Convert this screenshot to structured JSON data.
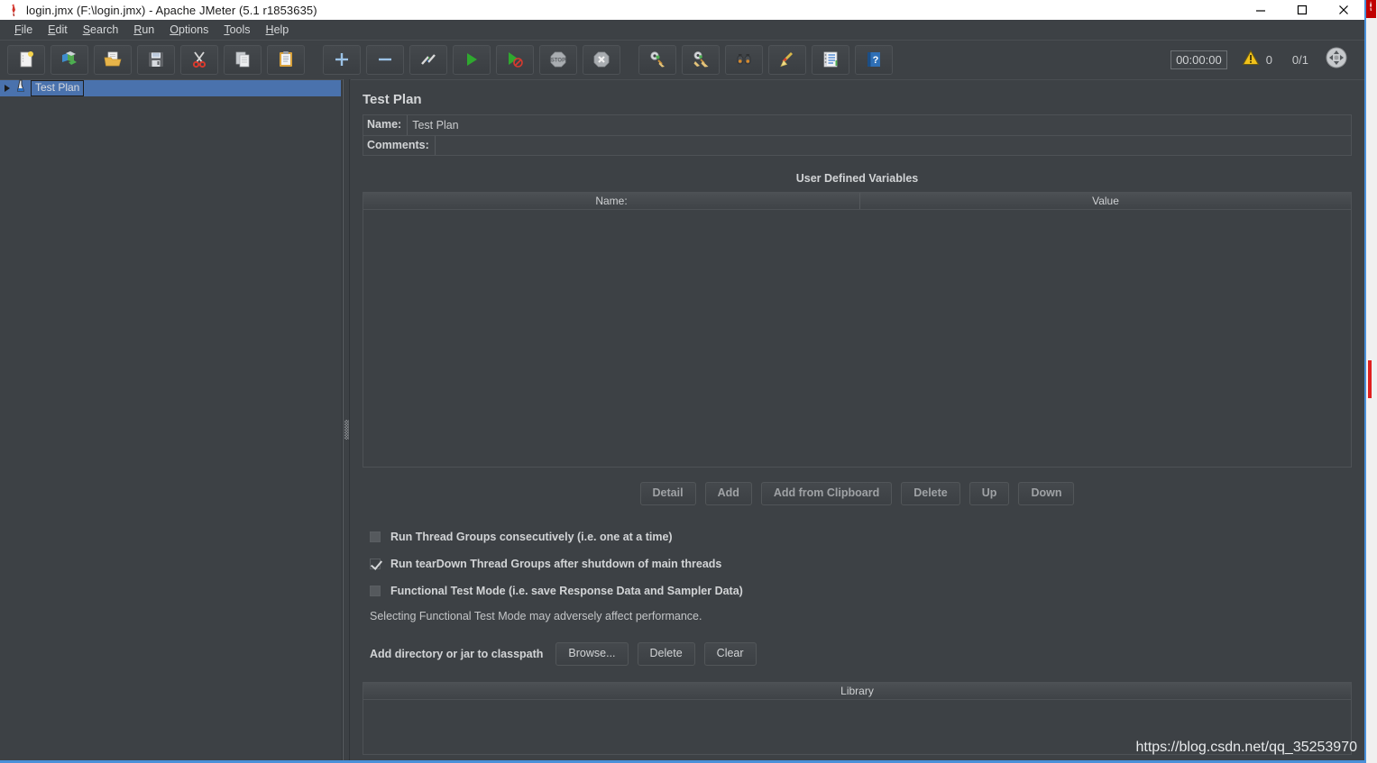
{
  "window": {
    "title": "login.jmx (F:\\login.jmx) - Apache JMeter (5.1 r1853635)",
    "app_icon": "jmeter-feather-icon",
    "minimize_label": "Minimize",
    "maximize_label": "Maximize",
    "close_label": "Close"
  },
  "menubar": {
    "items": [
      {
        "label": "File",
        "mnemonic": "F"
      },
      {
        "label": "Edit",
        "mnemonic": "E"
      },
      {
        "label": "Search",
        "mnemonic": "S"
      },
      {
        "label": "Run",
        "mnemonic": "R"
      },
      {
        "label": "Options",
        "mnemonic": "O"
      },
      {
        "label": "Tools",
        "mnemonic": "T"
      },
      {
        "label": "Help",
        "mnemonic": "H"
      }
    ]
  },
  "toolbar": {
    "groups": [
      [
        {
          "icon": "new-document-icon",
          "title": "New"
        },
        {
          "icon": "templates-icon",
          "title": "Templates"
        },
        {
          "icon": "open-folder-icon",
          "title": "Open"
        },
        {
          "icon": "save-floppy-icon",
          "title": "Save Test Plan"
        },
        {
          "icon": "cut-scissors-icon",
          "title": "Cut"
        },
        {
          "icon": "copy-pages-icon",
          "title": "Copy"
        },
        {
          "icon": "paste-clipboard-icon",
          "title": "Paste"
        }
      ],
      [
        {
          "icon": "expand-plus-icon",
          "title": "Expand All"
        },
        {
          "icon": "collapse-minus-icon",
          "title": "Collapse All"
        },
        {
          "icon": "toggle-icon",
          "title": "Toggle"
        },
        {
          "icon": "start-play-icon",
          "title": "Start"
        },
        {
          "icon": "start-no-pauses-icon",
          "title": "Start no pauses"
        },
        {
          "icon": "stop-octagon-icon",
          "title": "Stop"
        },
        {
          "icon": "shutdown-octagon-icon",
          "title": "Shutdown"
        }
      ],
      [
        {
          "icon": "clear-gear-broom-icon",
          "title": "Clear"
        },
        {
          "icon": "clear-all-broom-icon",
          "title": "Clear All"
        },
        {
          "icon": "search-binoculars-icon",
          "title": "Search"
        },
        {
          "icon": "reset-search-broom-icon",
          "title": "Reset Search"
        },
        {
          "icon": "function-helper-notepad-icon",
          "title": "Function Helper Dialog"
        },
        {
          "icon": "help-book-icon",
          "title": "Help"
        }
      ]
    ],
    "timer": "00:00:00",
    "warning_icon": "warning-triangle-icon",
    "warning_count": "0",
    "thread_count": "0/1",
    "status_icon": "refresh-circle-icon"
  },
  "tree": {
    "items": [
      {
        "label": "Test Plan",
        "icon": "test-plan-beaker-icon",
        "expander": "expand-triangle-icon",
        "selected": true
      }
    ]
  },
  "main": {
    "title": "Test Plan",
    "name_label": "Name:",
    "name_value": "Test Plan",
    "comments_label": "Comments:",
    "comments_value": "",
    "udv": {
      "title": "User Defined Variables",
      "columns": [
        "Name:",
        "Value"
      ],
      "rows": []
    },
    "udv_buttons": [
      {
        "label": "Detail",
        "enabled": false
      },
      {
        "label": "Add",
        "enabled": false
      },
      {
        "label": "Add from Clipboard",
        "enabled": false
      },
      {
        "label": "Delete",
        "enabled": false
      },
      {
        "label": "Up",
        "enabled": false
      },
      {
        "label": "Down",
        "enabled": false
      }
    ],
    "checkboxes": [
      {
        "label": "Run Thread Groups consecutively (i.e. one at a time)",
        "checked": false
      },
      {
        "label": "Run tearDown Thread Groups after shutdown of main threads",
        "checked": true
      },
      {
        "label": "Functional Test Mode (i.e. save Response Data and Sampler Data)",
        "checked": false
      }
    ],
    "note": "Selecting Functional Test Mode may adversely affect performance.",
    "classpath_label": "Add directory or jar to classpath",
    "classpath_buttons": [
      {
        "label": "Browse...",
        "enabled": true
      },
      {
        "label": "Delete",
        "enabled": true
      },
      {
        "label": "Clear",
        "enabled": true
      }
    ],
    "library": {
      "title": "Library",
      "rows": []
    }
  },
  "watermark": "https://blog.csdn.net/qq_35253970",
  "colors": {
    "background": "#3d4145",
    "selection": "#4a72ad",
    "accent_blue": "#4a90d9",
    "text": "#d2d4d6",
    "disabled_text": "#9fa2a5",
    "marker_red": "#c00000"
  }
}
